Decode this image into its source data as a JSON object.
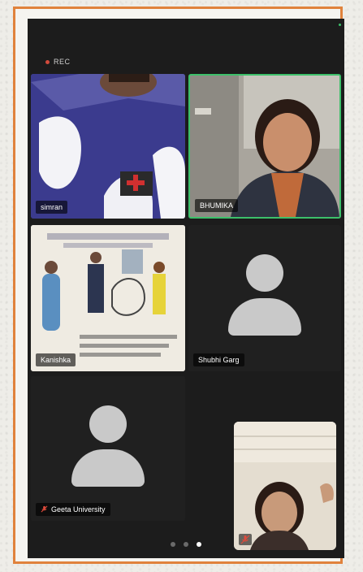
{
  "recording": {
    "label": "REC"
  },
  "tiles": [
    {
      "name": "simran"
    },
    {
      "name": "BHUMIKA"
    },
    {
      "name": "Kanishka"
    },
    {
      "name": "Shubhi Garg"
    },
    {
      "name": "Geeta University",
      "muted": true
    }
  ],
  "self_view": {
    "muted": true
  },
  "pager": {
    "pages": 3,
    "current": 3
  },
  "colors": {
    "frame": "#e0823c",
    "active_speaker": "#3cc06a",
    "recording_dot": "#d24a3c",
    "muted_mic": "#e04b3c"
  },
  "icons": [
    "muted-mic-icon",
    "participant-avatar-icon"
  ]
}
